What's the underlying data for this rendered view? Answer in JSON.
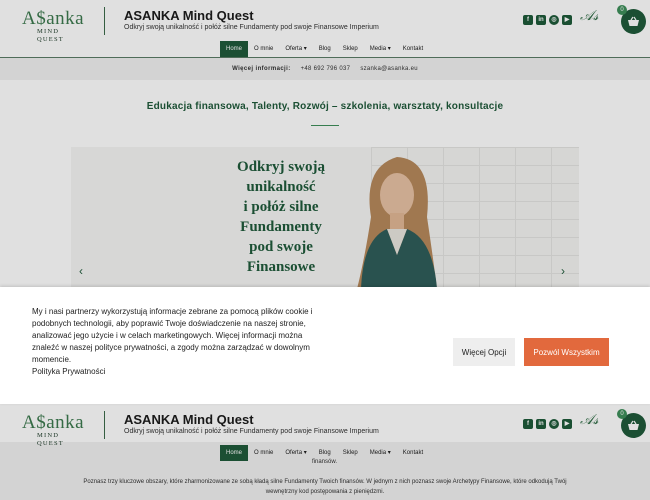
{
  "header": {
    "logo_main": "A$anka",
    "logo_sub": "MIND QUEST",
    "title": "ASANKA Mind Quest",
    "tagline": "Odkryj swoją unikalność i połóż silne Fundamenty pod swoje Finansowe Imperium",
    "social": [
      {
        "icon": "facebook-icon",
        "glyph": "f"
      },
      {
        "icon": "linkedin-icon",
        "glyph": "in"
      },
      {
        "icon": "instagram-icon",
        "glyph": "◎"
      },
      {
        "icon": "youtube-icon",
        "glyph": "▶"
      }
    ],
    "cart_count": "0"
  },
  "nav": {
    "items": [
      "Home",
      "O mnie",
      "Oferta ▾",
      "Blog",
      "Sklep",
      "Media ▾",
      "Kontakt"
    ]
  },
  "info_bar": {
    "label": "Więcej informacji:",
    "phone": "+48 692 796 037",
    "email": "szanka@asanka.eu"
  },
  "subtitle": "Edukacja finansowa, Talenty, Rozwój – szkolenia, warsztaty, konsultacje",
  "hero": {
    "lines": [
      "Odkryj swoją",
      "unikalność",
      "i połóż silne",
      "Fundamenty",
      "pod swoje",
      "Finansowe"
    ],
    "prev_arrow": "‹",
    "next_arrow": "›"
  },
  "cookie": {
    "text": "My i nasi partnerzy wykorzystują informacje zebrane za pomocą plików cookie i podobnych technologii, aby poprawić Twoje doświadczenie na naszej stronie, analizować jego użycie i w celach marketingowych. Więcej informacji można znaleźć w naszej polityce prywatności, a zgody można zarządzać w dowolnym momencie.",
    "policy_link": "Polityka Prywatności",
    "more_button": "Więcej Opcji",
    "accept_button": "Pozwól Wszystkim"
  },
  "bottom": {
    "stub": "finansów.",
    "text": "Poznasz trzy kluczowe obszary, które zharmonizowane ze sobą kładą silne Fundamenty Twoich finansów. W jednym z nich poznasz swoje Archetypy Finansowe, które odkodują Twój wewnętrzny kod postępowania z pieniędzmi."
  },
  "colors": {
    "brand_green": "#1f5a3b",
    "accent_orange": "#e2693d"
  }
}
